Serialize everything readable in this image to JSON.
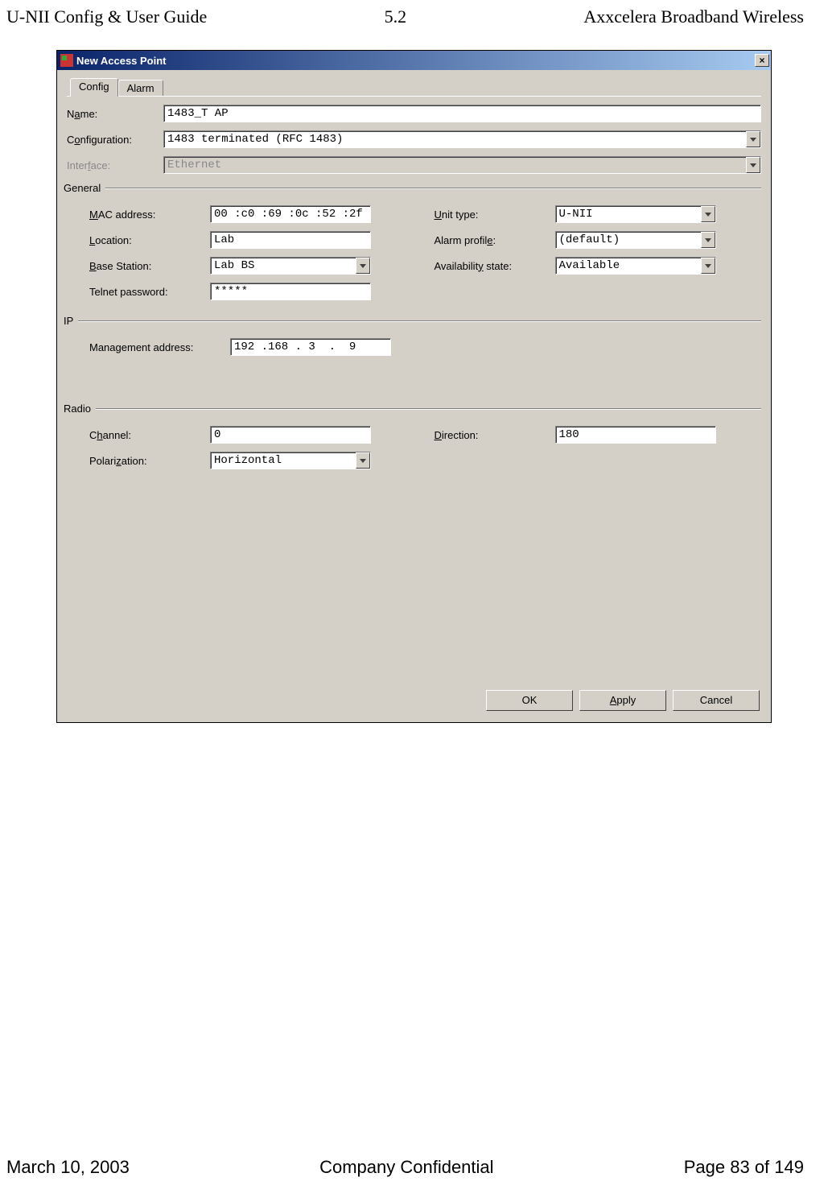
{
  "page_header": {
    "left": "U-NII Config & User Guide",
    "mid": "5.2",
    "right": "Axxcelera Broadband Wireless"
  },
  "page_footer": {
    "left": "March 10, 2003",
    "mid": "Company Confidential",
    "right": "Page 83 of 149"
  },
  "titlebar": {
    "title": "New Access Point",
    "close_glyph": "×"
  },
  "tabs": {
    "config": "Config",
    "alarm": "Alarm"
  },
  "fields": {
    "name_label_pre": "N",
    "name_label_ul": "a",
    "name_label_post": "me:",
    "name_value": "1483_T AP",
    "config_label_pre": "C",
    "config_label_ul": "o",
    "config_label_post": "nfiguration:",
    "config_value": "1483 terminated (RFC 1483)",
    "interface_label_pre": "Inter",
    "interface_label_ul": "f",
    "interface_label_post": "ace:",
    "interface_value": "Ethernet"
  },
  "general": {
    "title": "General",
    "mac_label_ul": "M",
    "mac_label_post": "AC address:",
    "mac_value": "00 :c0 :69 :0c :52 :2f",
    "location_label_ul": "L",
    "location_label_post": "ocation:",
    "location_value": "Lab",
    "base_label_ul": "B",
    "base_label_post": "ase Station:",
    "base_value": "Lab BS",
    "telnet_label": "Telnet password:",
    "telnet_value": "*****",
    "unit_label_ul": "U",
    "unit_label_post": "nit type:",
    "unit_value": "U-NII",
    "alarm_label_pre": "Alarm profil",
    "alarm_label_ul": "e",
    "alarm_label_post": ":",
    "alarm_value": "(default)",
    "avail_label_pre": "Availabilit",
    "avail_label_ul": "y",
    "avail_label_post": " state:",
    "avail_value": "Available"
  },
  "ip": {
    "title": "IP",
    "mgmt_label_pre": "Mana",
    "mgmt_label_ul": "g",
    "mgmt_label_post": "ement address:",
    "mgmt_value": "192 .168 . 3  .  9"
  },
  "radio": {
    "title": "Radio",
    "channel_label_pre": "C",
    "channel_label_ul": "h",
    "channel_label_post": "annel:",
    "channel_value": "0",
    "polar_label_pre": "Polari",
    "polar_label_ul": "z",
    "polar_label_post": "ation:",
    "polar_value": "Horizontal",
    "dir_label_ul": "D",
    "dir_label_post": "irection:",
    "dir_value": "180"
  },
  "buttons": {
    "ok": "OK",
    "apply_ul": "A",
    "apply_post": "pply",
    "cancel": "Cancel"
  }
}
